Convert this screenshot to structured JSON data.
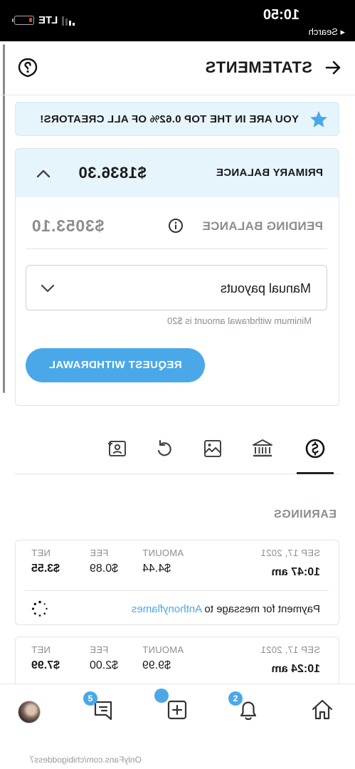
{
  "status_bar": {
    "time": "10:50",
    "back_label": "◂ Search",
    "carrier": "LTE"
  },
  "header": {
    "title": "STATEMENTS"
  },
  "banner": {
    "text": "YOU ARE IN THE TOP 0.62% OF ALL CREATORS!"
  },
  "balance_card": {
    "primary_label": "PRIMARY BALANCE",
    "primary_amount": "$1836.30",
    "pending_label": "PENDING BALANCE",
    "pending_amount": "$3053.10",
    "payout_mode": "Manual payouts",
    "min_note": "Minimum withdrawal amount is $20",
    "withdraw_button": "REQUEST WITHDRAWAL"
  },
  "section_title": "EARNINGS",
  "transactions": [
    {
      "date": "SEP 17, 2021",
      "time": "10:47 am",
      "amount_label": "AMOUNT",
      "amount": "$4.44",
      "fee_label": "FEE",
      "fee": "$0.89",
      "net_label": "NET",
      "net": "$3.55",
      "desc_prefix": "Payment for message to ",
      "desc_link": "Anthonyflames"
    },
    {
      "date": "SEP 17, 2021",
      "time": "10:24 am",
      "amount_label": "AMOUNT",
      "amount": "$9.99",
      "fee_label": "FEE",
      "fee": "$2.00",
      "net_label": "NET",
      "net": "$7.99"
    }
  ],
  "bottom_nav": {
    "messages_badge": "5",
    "notifications_badge": "2"
  },
  "footer_url": "OnlyFans.com/chibigoddess7",
  "colors": {
    "accent": "#4aa8e8",
    "banner_bg": "#e6f4fb",
    "muted": "#8a8d91"
  },
  "icons": [
    "back-arrow-icon",
    "help-icon",
    "star-icon",
    "chevron-up-icon",
    "info-icon",
    "chevron-down-icon",
    "dollar-icon",
    "bank-icon",
    "image-icon",
    "redo-icon",
    "contact-icon",
    "spinner-icon",
    "home-icon",
    "bell-icon",
    "add-icon",
    "chat-icon"
  ]
}
